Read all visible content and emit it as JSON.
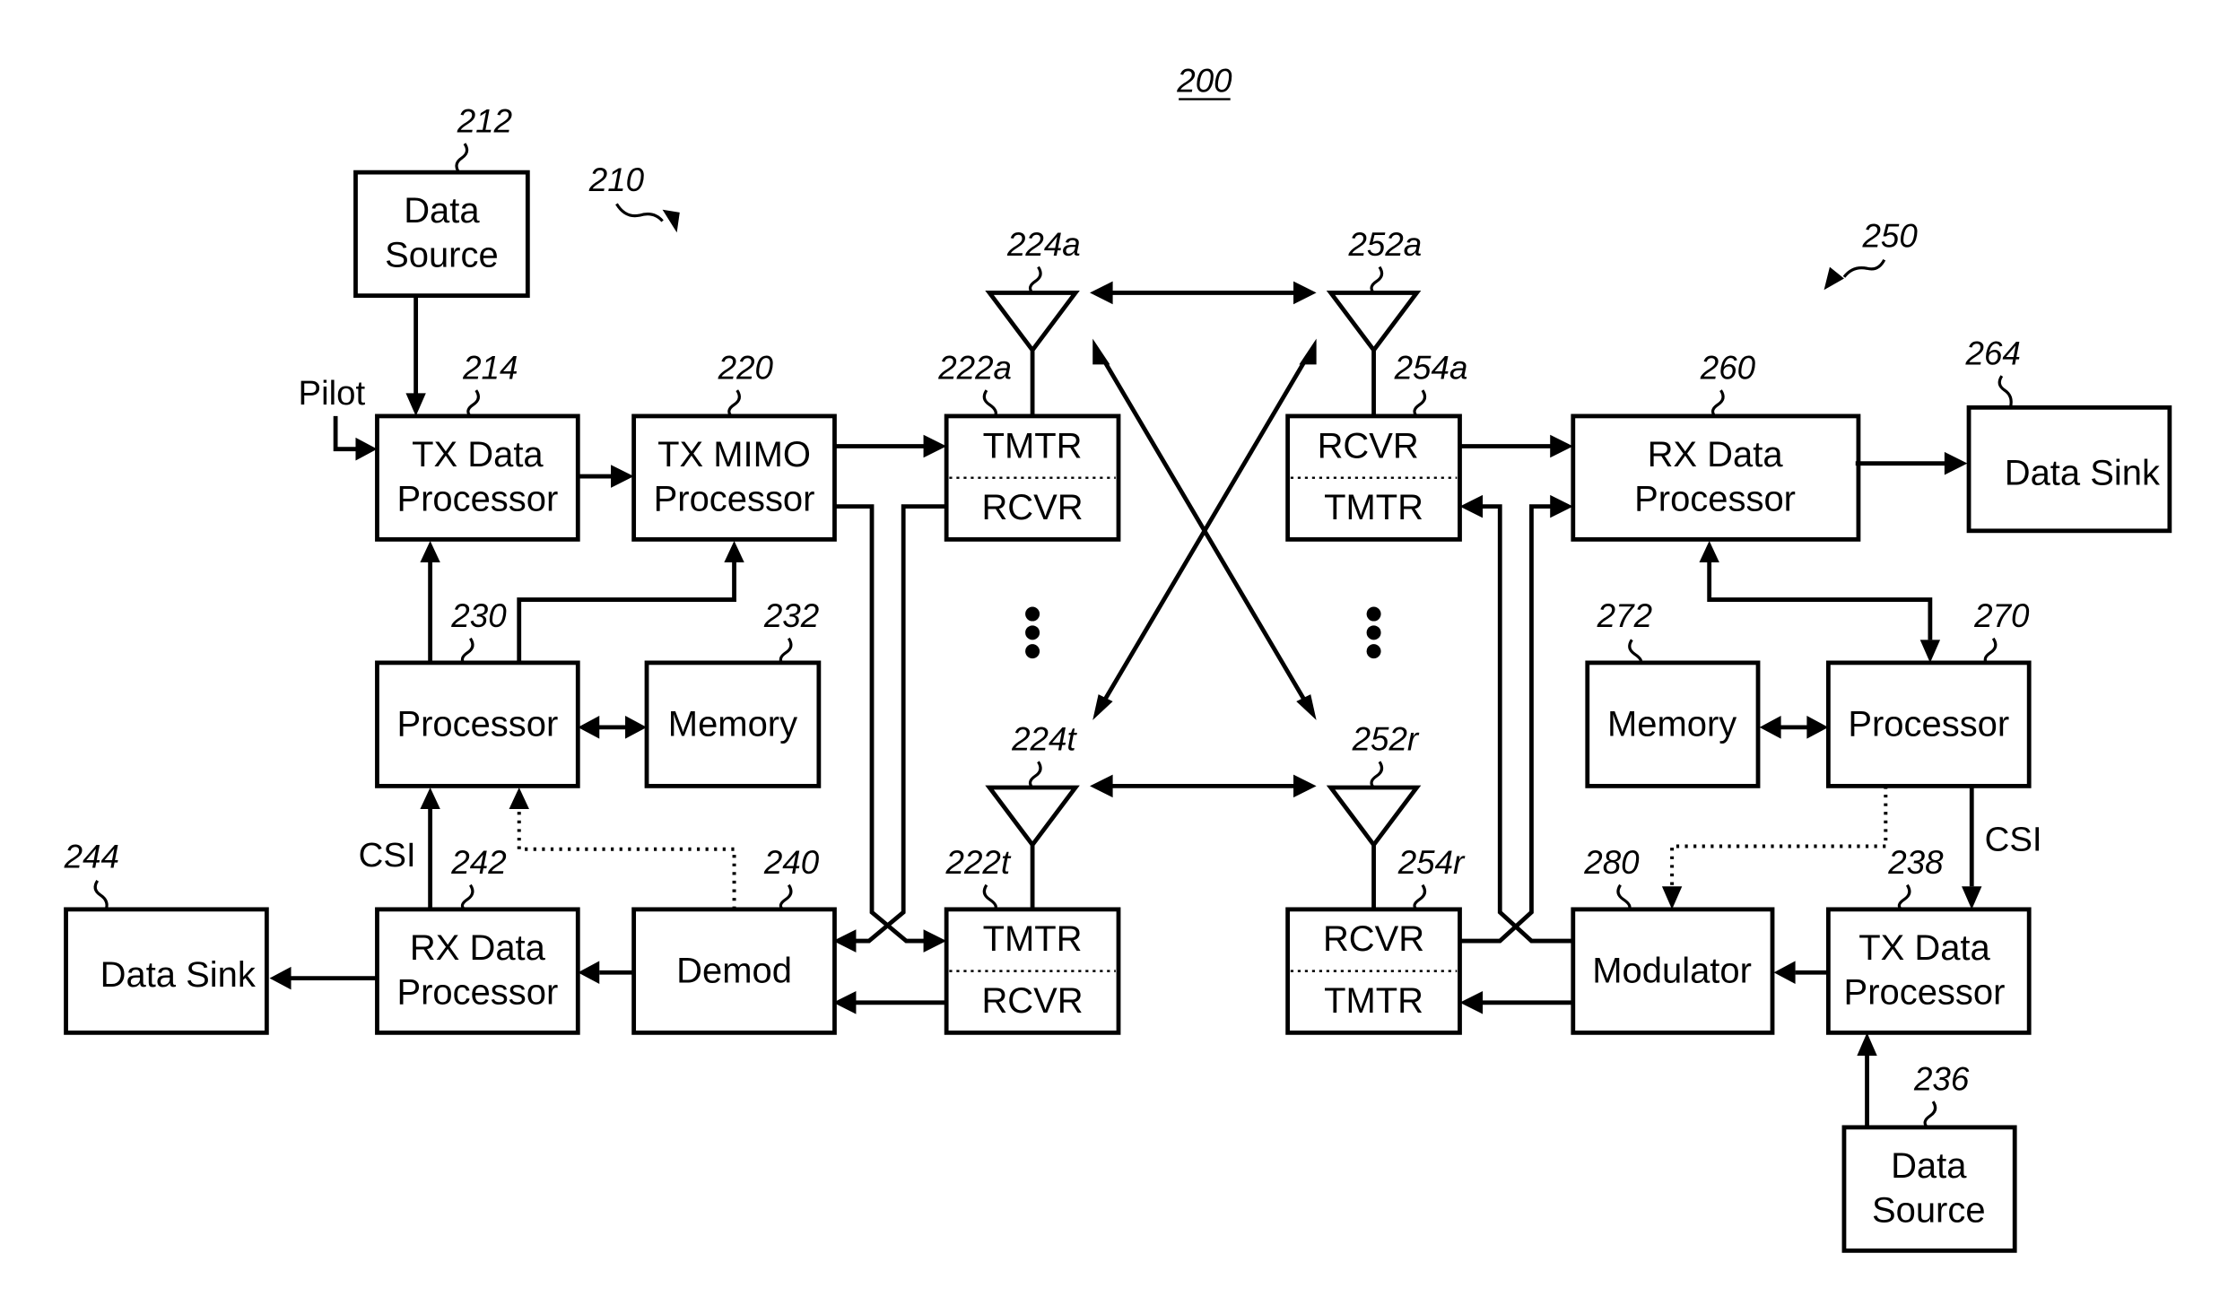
{
  "figure": {
    "number": "200",
    "transmitter_ref": "210",
    "receiver_ref": "250"
  },
  "blocks": {
    "data_source_tx": {
      "line1": "Data",
      "line2": "Source",
      "ref": "212"
    },
    "tx_data_proc_tx": {
      "line1": "TX Data",
      "line2": "Processor",
      "ref": "214"
    },
    "tx_mimo_proc": {
      "line1": "TX MIMO",
      "line2": "Processor",
      "ref": "220"
    },
    "transceiver_222a": {
      "top": "TMTR",
      "bottom": "RCVR",
      "ref": "222a"
    },
    "transceiver_222t": {
      "top": "TMTR",
      "bottom": "RCVR",
      "ref": "222t"
    },
    "processor_tx": {
      "label": "Processor",
      "ref": "230"
    },
    "memory_tx": {
      "label": "Memory",
      "ref": "232"
    },
    "demod": {
      "label": "Demod",
      "ref": "240"
    },
    "rx_data_proc_tx": {
      "line1": "RX Data",
      "line2": "Processor",
      "ref": "242"
    },
    "data_sink_tx": {
      "label": "Data Sink",
      "ref": "244"
    },
    "transceiver_254a": {
      "top": "RCVR",
      "bottom": "TMTR",
      "ref": "254a"
    },
    "transceiver_254r": {
      "top": "RCVR",
      "bottom": "TMTR",
      "ref": "254r"
    },
    "rx_data_proc_rx": {
      "line1": "RX Data",
      "line2": "Processor",
      "ref": "260"
    },
    "data_sink_rx": {
      "label": "Data Sink",
      "ref": "264"
    },
    "memory_rx": {
      "label": "Memory",
      "ref": "272"
    },
    "processor_rx": {
      "label": "Processor",
      "ref": "270"
    },
    "modulator": {
      "label": "Modulator",
      "ref": "280"
    },
    "tx_data_proc_rx": {
      "line1": "TX Data",
      "line2": "Processor",
      "ref": "238"
    },
    "data_source_rx": {
      "line1": "Data",
      "line2": "Source",
      "ref": "236"
    }
  },
  "antennas": {
    "a224a": "224a",
    "a224t": "224t",
    "a252a": "252a",
    "a252r": "252r"
  },
  "signals": {
    "pilot": "Pilot",
    "csi_tx": "CSI",
    "csi_rx": "CSI"
  }
}
